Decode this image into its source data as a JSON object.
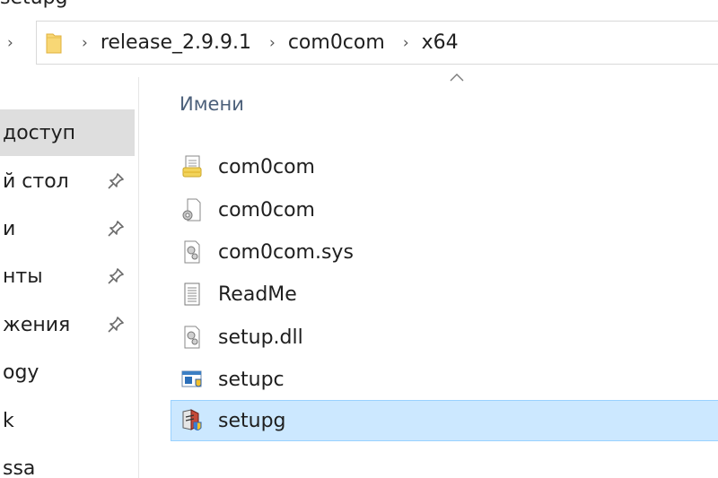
{
  "window": {
    "title_cropped": "setupg"
  },
  "addressbar": {
    "breadcrumb": [
      "release_2.9.9.1",
      "com0com",
      "x64"
    ]
  },
  "sidebar": {
    "items": [
      {
        "label": "доступ",
        "pinned": false,
        "active": true
      },
      {
        "label": "й стол",
        "pinned": true,
        "active": false
      },
      {
        "label": "и",
        "pinned": true,
        "active": false
      },
      {
        "label": "нты",
        "pinned": true,
        "active": false
      },
      {
        "label": "жения",
        "pinned": true,
        "active": false
      },
      {
        "label": "ogy",
        "pinned": false,
        "active": false
      },
      {
        "label": "k",
        "pinned": false,
        "active": false
      },
      {
        "label": "ssa",
        "pinned": false,
        "active": false
      }
    ]
  },
  "content": {
    "column_header": "Имени",
    "files": [
      {
        "name": "com0com",
        "icon": "setup-info-icon",
        "selected": false
      },
      {
        "name": "com0com",
        "icon": "catalog-gear-icon",
        "selected": false
      },
      {
        "name": "com0com.sys",
        "icon": "system-file-icon",
        "selected": false
      },
      {
        "name": "ReadMe",
        "icon": "text-document-icon",
        "selected": false
      },
      {
        "name": "setup.dll",
        "icon": "dll-gear-icon",
        "selected": false
      },
      {
        "name": "setupc",
        "icon": "console-shield-icon",
        "selected": false
      },
      {
        "name": "setupg",
        "icon": "installer-shield-icon",
        "selected": true
      }
    ]
  },
  "colors": {
    "selection_bg": "#cce8ff",
    "selection_border": "#99d1ff",
    "sidebar_active": "#dedede",
    "header_text": "#4c607a"
  }
}
